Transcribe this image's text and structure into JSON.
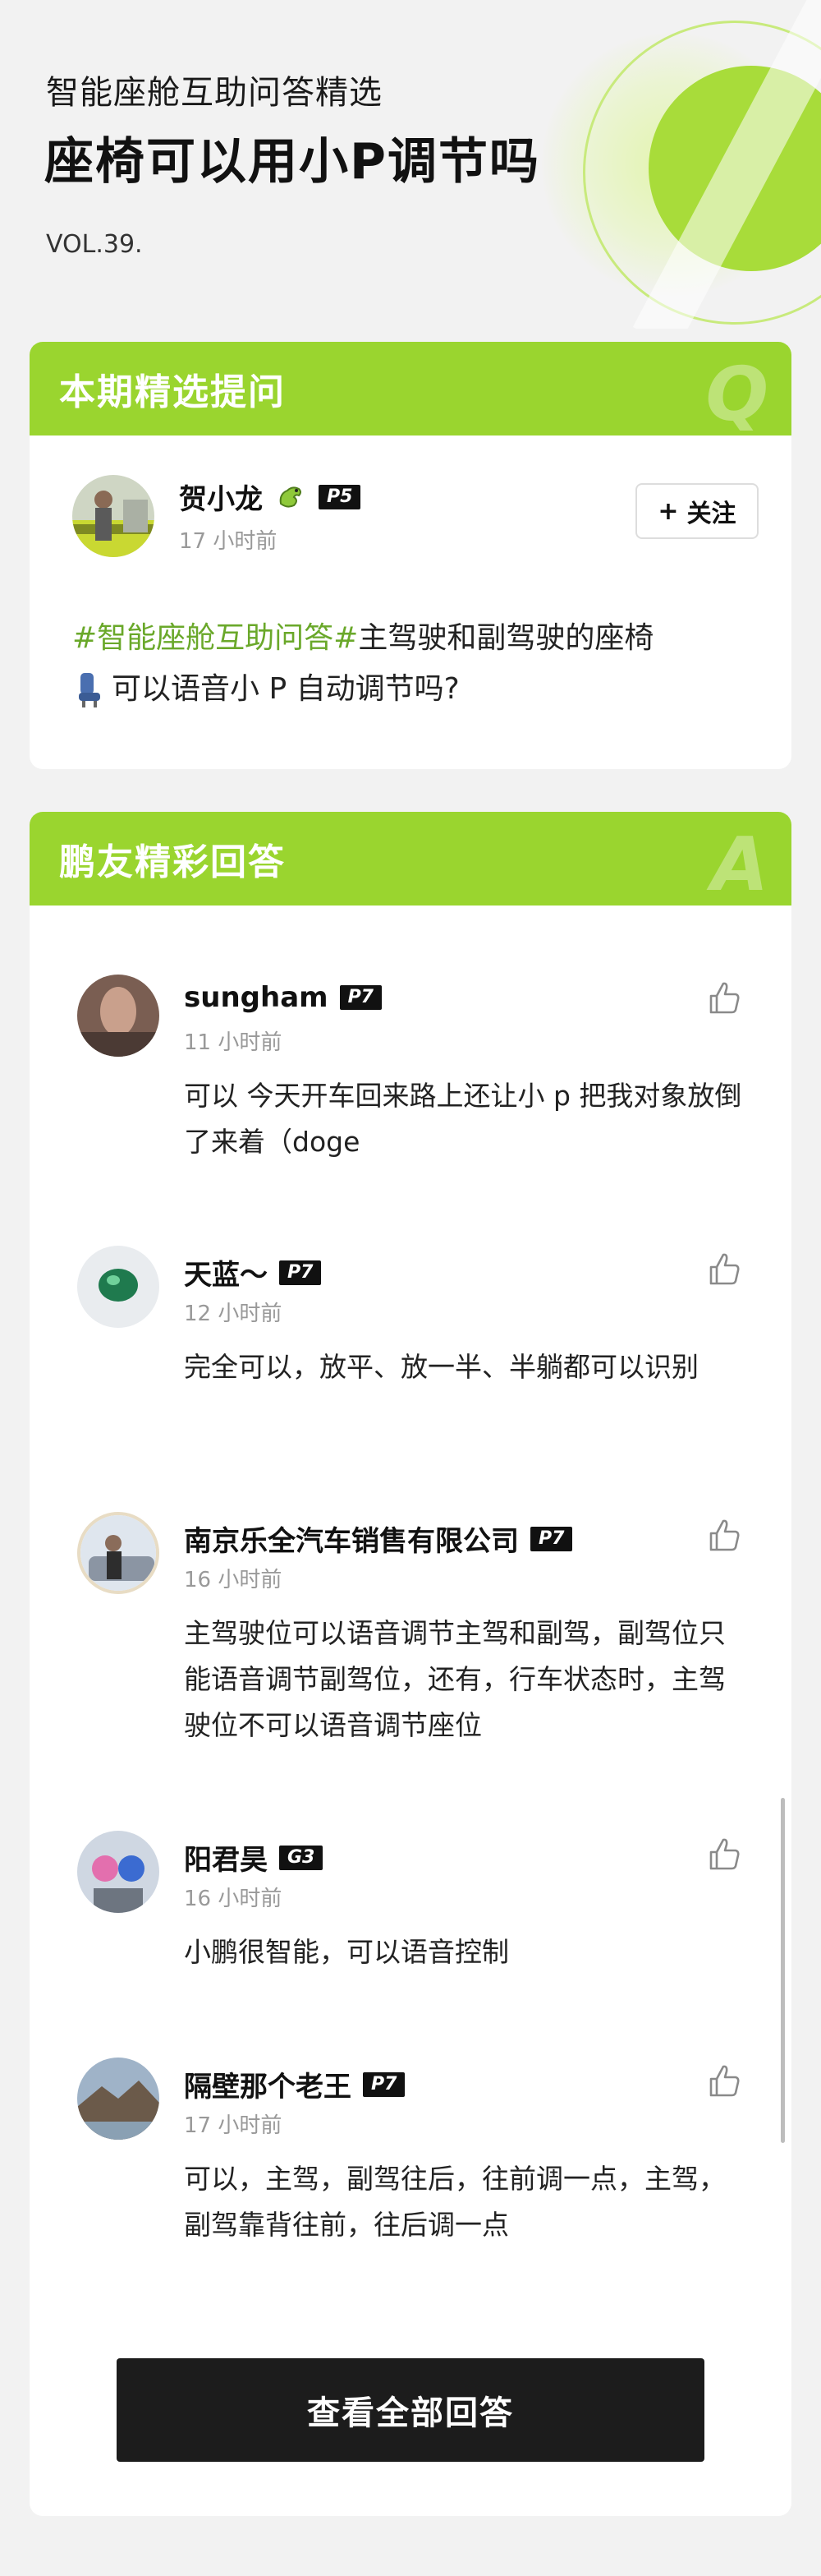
{
  "header": {
    "subtitle": "智能座舱互助问答精选",
    "title": "座椅可以用小P调节吗",
    "volume": "VOL.39."
  },
  "question_card": {
    "heading": "本期精选提问",
    "heading_letter": "Q",
    "user": {
      "name": "贺小龙",
      "level": "P5",
      "time": "17 小时前"
    },
    "follow_label": "关注",
    "follow_icon": "plus-icon",
    "tag": "#智能座舱互助问答#",
    "text_line1": "主驾驶和副驾驶的座椅",
    "text_line2": "可以语音小 P 自动调节吗?"
  },
  "answers_card": {
    "heading": "鹏友精彩回答",
    "heading_letter": "A",
    "answers": [
      {
        "name": "sungham",
        "level": "P7",
        "time": "11 小时前",
        "text": "可以 今天开车回来路上还让小 p 把我对象放倒了来着（doge"
      },
      {
        "name": "天蓝～",
        "level": "P7",
        "time": "12 小时前",
        "text": "完全可以，放平、放一半、半躺都可以识别"
      },
      {
        "name": "南京乐全汽车销售有限公司",
        "level": "P7",
        "time": "16 小时前",
        "text": "主驾驶位可以语音调节主驾和副驾，副驾位只能语音调节副驾位，还有，行车状态时，主驾驶位不可以语音调节座位"
      },
      {
        "name": "阳君昊",
        "level": "G3",
        "time": "16 小时前",
        "text": "小鹏很智能，可以语音控制"
      },
      {
        "name": "隔壁那个老王",
        "level": "P7",
        "time": "17 小时前",
        "text": "可以，主驾，副驾往后，往前调一点，主驾，副驾靠背往前，往后调一点"
      }
    ],
    "view_all_label": "查看全部回答"
  },
  "colors": {
    "accent_green": "#9ad52f",
    "tag_green": "#6aa82a",
    "dark_button": "#1c1c1c"
  }
}
